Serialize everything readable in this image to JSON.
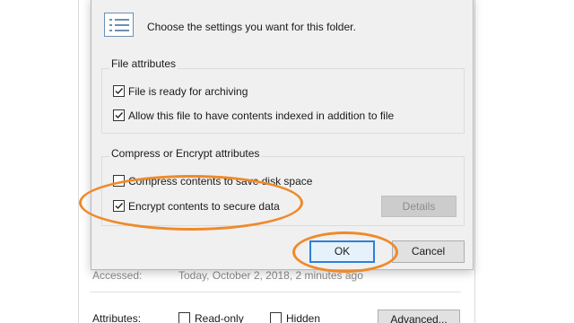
{
  "dialog": {
    "header_text": "Choose the settings you want for this folder.",
    "file_attributes": {
      "title": "File attributes",
      "items": [
        {
          "label": "File is ready for archiving",
          "checked": true
        },
        {
          "label": "Allow this file to have contents indexed in addition to file",
          "checked": true
        }
      ]
    },
    "compress_encrypt": {
      "title": "Compress or Encrypt attributes",
      "items": [
        {
          "label": "Compress contents to save disk space",
          "checked": false
        },
        {
          "label": "Encrypt contents to secure data",
          "checked": true
        }
      ],
      "details_label": "Details"
    },
    "ok_label": "OK",
    "cancel_label": "Cancel"
  },
  "background": {
    "accessed_label": "Accessed:",
    "accessed_value": "Today, October 2, 2018, 2 minutes ago",
    "attributes_label": "Attributes:",
    "readonly_label": "Read-only",
    "hidden_label": "Hidden",
    "advanced_label": "Advanced..."
  },
  "colors": {
    "annotation": "#ee8a2a",
    "default_button_border": "#2f7fd8"
  }
}
